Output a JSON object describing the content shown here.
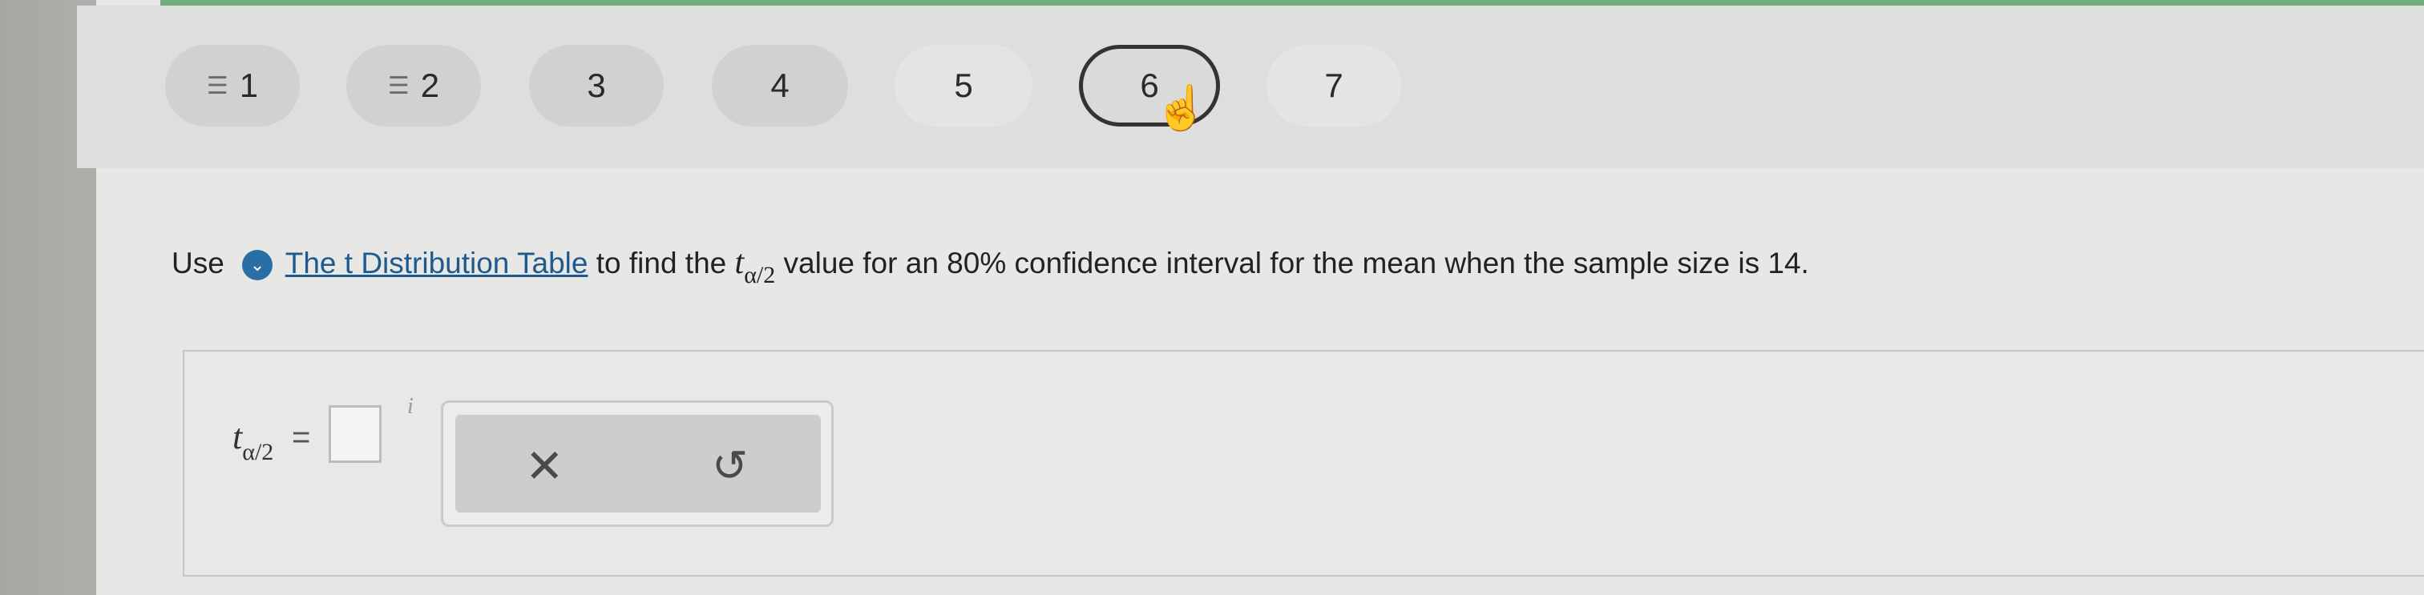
{
  "nav": {
    "items": [
      {
        "label": "1",
        "icon": "list-icon"
      },
      {
        "label": "2",
        "icon": "list-icon"
      },
      {
        "label": "3"
      },
      {
        "label": "4"
      },
      {
        "label": "5"
      },
      {
        "label": "6",
        "active": true
      },
      {
        "label": "7"
      }
    ]
  },
  "question": {
    "prefix": "Use",
    "link_text": "The t Distribution Table",
    "after_link": "to find the",
    "symbol": "t",
    "subscript": "α/2",
    "rest": "value for an 80% confidence interval for the mean when the sample size is 14."
  },
  "answer": {
    "symbol": "t",
    "subscript": "α/2",
    "equals": "=",
    "value": ""
  },
  "tools": {
    "clear_icon": "close-icon",
    "undo_icon": "undo-icon"
  },
  "colors": {
    "link": "#1f5a8e",
    "accent_top": "#6fae7a",
    "info_dot": "#2a6ea6"
  }
}
